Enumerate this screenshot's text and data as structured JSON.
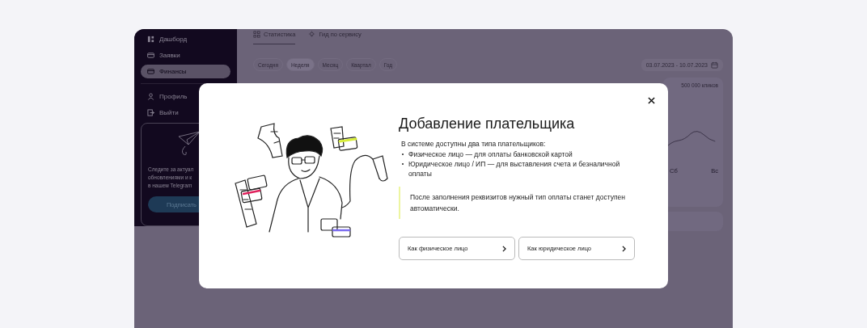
{
  "sidebar": {
    "items": [
      {
        "label": "Дашборд",
        "selected": false
      },
      {
        "label": "Заявки",
        "selected": false
      },
      {
        "label": "Финансы",
        "selected": true
      }
    ],
    "bottom_items": [
      {
        "label": "Профиль"
      },
      {
        "label": "Выйти"
      }
    ],
    "promo": {
      "lines": [
        "Следите за актуал",
        "обновлениями и к",
        "в нашем Telegram"
      ],
      "button": "Подписать"
    }
  },
  "tabs": [
    {
      "label": "Статистика",
      "selected": true
    },
    {
      "label": "Гид по сервису",
      "selected": false
    }
  ],
  "periods": [
    {
      "label": "Сегодня",
      "selected": false
    },
    {
      "label": "Неделя",
      "selected": true
    },
    {
      "label": "Месяц",
      "selected": false
    },
    {
      "label": "Квартал",
      "selected": false
    },
    {
      "label": "Год",
      "selected": false
    }
  ],
  "date_range": "03.07.2023 - 10.07.2023",
  "chart_card": {
    "caption": "500 000 кликов",
    "x_labels": [
      "Сб",
      "Вс"
    ]
  },
  "modal": {
    "title": "Добавление плательщика",
    "intro": "В системе доступны два типа плательщиков:",
    "bullets": [
      "Физическое лицо — для оплаты банковской картой",
      "Юридическое лицо / ИП — для выставления счета и безналичной оплаты"
    ],
    "note": "После заполнения реквизитов нужный тип оплаты станет доступен автоматически.",
    "buttons": [
      {
        "label": "Как физическое лицо",
        "selected": false
      },
      {
        "label": "Как юридическое лицо",
        "selected": false
      }
    ]
  }
}
